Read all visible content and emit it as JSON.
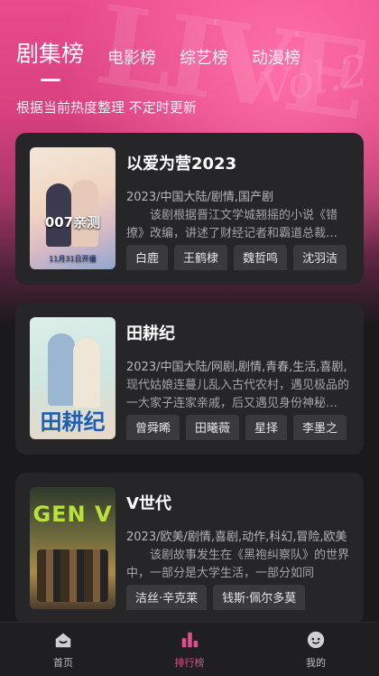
{
  "tabs": [
    {
      "label": "剧集榜",
      "active": true
    },
    {
      "label": "电影榜",
      "active": false
    },
    {
      "label": "综艺榜",
      "active": false
    },
    {
      "label": "动漫榜",
      "active": false
    }
  ],
  "subtitle": "根据当前热度整理 不定时更新",
  "cards": [
    {
      "title": "以爱为营2023",
      "meta": "2023/中国大陆/剧情,国产剧",
      "desc": "该剧根据晋江文学城翘摇的小说《错撩》改编，讲述了财经记者和霸道总裁的故事",
      "poster_text": "007亲测",
      "poster_date": "11月31日开播",
      "tags": [
        "白鹿",
        "王鹤棣",
        "魏哲鸣",
        "沈羽洁"
      ]
    },
    {
      "title": "田耕纪",
      "meta": "2023/中国大陆/网剧,剧情,青春,生活,喜剧,",
      "desc": "现代姑娘连蔓儿乱入古代农村，遇见极品的一大家子连家亲戚，后又遇见身份神秘的少年",
      "poster_text": "田耕纪",
      "tags": [
        "曾舜晞",
        "田曦薇",
        "星择",
        "李墨之"
      ]
    },
    {
      "title": "V世代",
      "meta": "2023/欧美/剧情,喜剧,动作,科幻,冒险,欧美",
      "desc": "该剧故事发生在《黑袍纠察队》的世界中，一部分是大学生活，一部分如同",
      "poster_text": "GEN V",
      "tags": [
        "洁丝·辛克莱",
        "钱斯·佩尔多莫"
      ]
    }
  ],
  "nav": [
    {
      "label": "首页",
      "icon": "home-icon",
      "active": false
    },
    {
      "label": "排行榜",
      "icon": "chart-icon",
      "active": true
    },
    {
      "label": "我的",
      "icon": "profile-icon",
      "active": false
    }
  ],
  "colors": {
    "accent": "#e04f8d",
    "hero_pink": "#e94b8c",
    "card_bg": "#262628",
    "tag_bg": "#3a3a3c",
    "page_bg": "#1a1a1c"
  }
}
